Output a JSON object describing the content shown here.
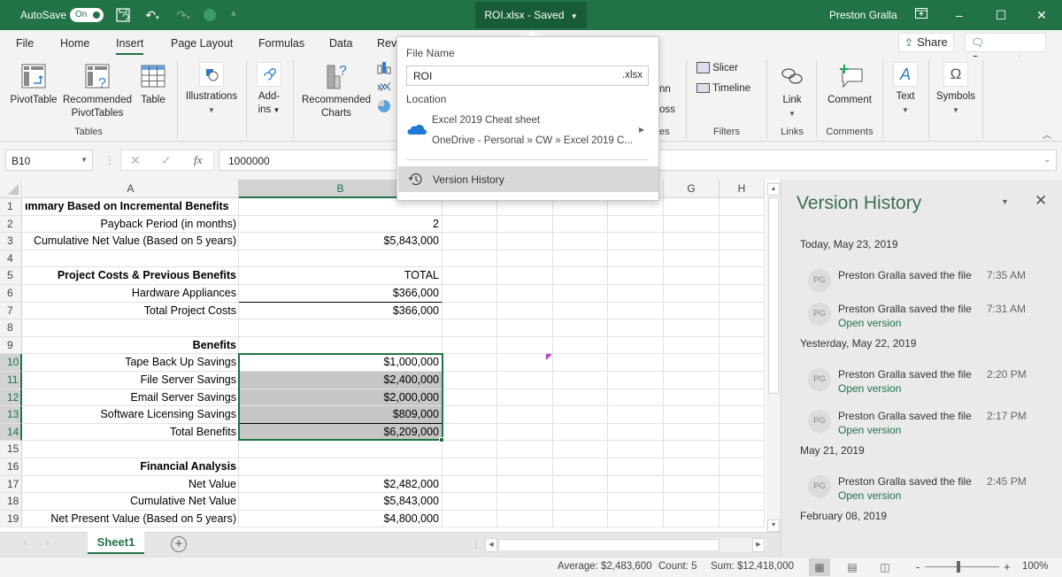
{
  "titlebar": {
    "autosave_label": "AutoSave",
    "autosave_state": "On",
    "title": "ROI.xlsx - Saved",
    "user": "Preston Gralla"
  },
  "ribbon_tabs": [
    "File",
    "Home",
    "Insert",
    "Page Layout",
    "Formulas",
    "Data",
    "Rev"
  ],
  "active_tab": "Insert",
  "share_label": "Share",
  "comments_label": "Comments",
  "ribbon": {
    "tables": {
      "group": "Tables",
      "pivot_table": "PivotTable",
      "recommended_pivot_1": "Recommended",
      "recommended_pivot_2": "PivotTables",
      "table": "Table"
    },
    "illustrations": "Illustrations",
    "addins_1": "Add-",
    "addins_2": "ins",
    "recommended_charts_1": "Recommended",
    "recommended_charts_2": "Charts",
    "partial_sparkline_1": "nn",
    "partial_sparkline_2": "oss",
    "partial_group": "es",
    "filters": {
      "group": "Filters",
      "slicer": "Slicer",
      "timeline": "Timeline"
    },
    "links": {
      "group": "Links",
      "link": "Link"
    },
    "comments": {
      "group": "Comments",
      "comment": "Comment"
    },
    "text": "Text",
    "symbols": "Symbols"
  },
  "formula_bar": {
    "name_box": "B10",
    "fx": "fx",
    "value": "1000000"
  },
  "columns": [
    "A",
    "B",
    "C",
    "D",
    "E",
    "F",
    "G",
    "H"
  ],
  "selected_column": "B",
  "rows": [
    {
      "n": "1",
      "a": "ımmary Based on Incremental Benefits",
      "b": "",
      "a_bold": true
    },
    {
      "n": "2",
      "a": "Payback Period (in months)",
      "b": "2"
    },
    {
      "n": "3",
      "a": "Cumulative Net Value  (Based on 5 years)",
      "b": "$5,843,000"
    },
    {
      "n": "4",
      "a": "",
      "b": ""
    },
    {
      "n": "5",
      "a": "Project Costs & Previous Benefits",
      "b": "TOTAL",
      "a_bold": true
    },
    {
      "n": "6",
      "a": "Hardware Appliances",
      "b": "$366,000"
    },
    {
      "n": "7",
      "a": "Total Project Costs",
      "b": "$366,000"
    },
    {
      "n": "8",
      "a": "",
      "b": ""
    },
    {
      "n": "9",
      "a": "Benefits",
      "b": "",
      "a_bold": true
    },
    {
      "n": "10",
      "a": "Tape Back Up Savings",
      "b": "$1,000,000"
    },
    {
      "n": "11",
      "a": "File Server Savings",
      "b": "$2,400,000"
    },
    {
      "n": "12",
      "a": "Email Server Savings",
      "b": "$2,000,000"
    },
    {
      "n": "13",
      "a": "Software Licensing Savings",
      "b": "$809,000"
    },
    {
      "n": "14",
      "a": "Total Benefits",
      "b": "$6,209,000"
    },
    {
      "n": "15",
      "a": "",
      "b": ""
    },
    {
      "n": "16",
      "a": "Financial Analysis",
      "b": "",
      "a_bold": true
    },
    {
      "n": "17",
      "a": "Net Value",
      "b": "$2,482,000"
    },
    {
      "n": "18",
      "a": "Cumulative Net Value ",
      "b": "$5,843,000"
    },
    {
      "n": "19",
      "a": "Net Present Value (Based on 5 years)",
      "b": "$4,800,000"
    }
  ],
  "sheet_tabs": [
    "Sheet1"
  ],
  "status": {
    "average": "Average: $2,483,600",
    "count": "Count: 5",
    "sum": "Sum: $12,418,000",
    "zoom": "100%"
  },
  "popup": {
    "file_name_label": "File Name",
    "file_name": "ROI",
    "extension": ".xlsx",
    "location_label": "Location",
    "location_folder": "Excel 2019 Cheat sheet",
    "location_path": "OneDrive - Personal » CW » Excel 2019 C...",
    "version_history": "Version History"
  },
  "version_history": {
    "title": "Version History",
    "groups": [
      {
        "date": "Today, May 23, 2019",
        "entries": [
          {
            "initials": "PG",
            "text": "Preston Gralla saved the file",
            "time": "7:35 AM",
            "open": ""
          },
          {
            "initials": "PG",
            "text": "Preston Gralla saved the file",
            "time": "7:31 AM",
            "open": "Open version"
          }
        ]
      },
      {
        "date": "Yesterday, May 22, 2019",
        "entries": [
          {
            "initials": "PG",
            "text": "Preston Gralla saved the file",
            "time": "2:20 PM",
            "open": "Open version"
          },
          {
            "initials": "PG",
            "text": "Preston Gralla saved the file",
            "time": "2:17 PM",
            "open": "Open version"
          }
        ]
      },
      {
        "date": "May 21, 2019",
        "entries": [
          {
            "initials": "PG",
            "text": "Preston Gralla saved the file",
            "time": "2:45 PM",
            "open": "Open version"
          }
        ]
      },
      {
        "date": "February 08, 2019",
        "entries": []
      }
    ]
  },
  "colors": {
    "brand": "#217346",
    "selection_fill": "#c6c6c6",
    "comment_marker": "#b146c2"
  }
}
